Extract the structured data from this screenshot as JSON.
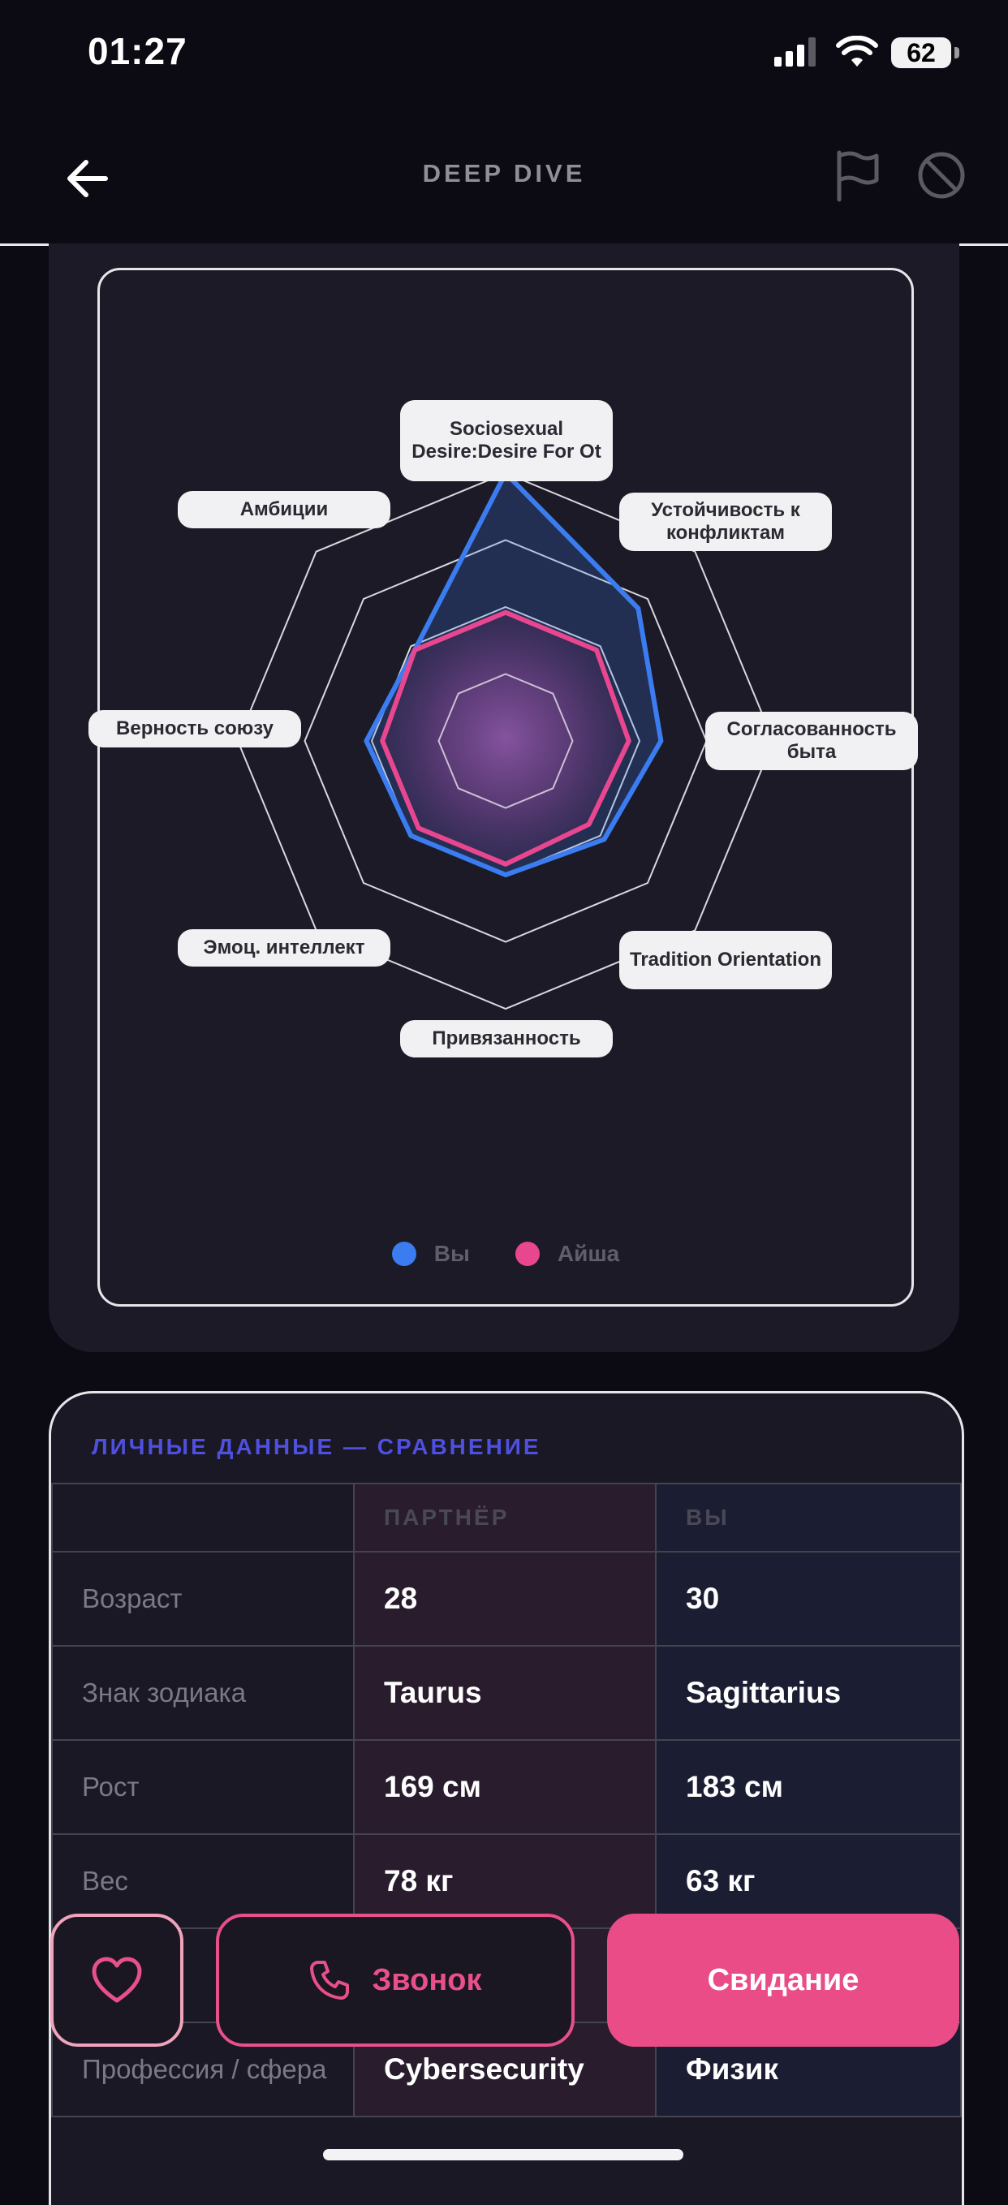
{
  "status": {
    "time": "01:27",
    "battery": "62"
  },
  "nav": {
    "title": "DEEP DIVE"
  },
  "radar": {
    "axes": [
      "Sociosexual Desire:Desire For Ot",
      "Устойчивость к конфликтам",
      "Согласованность быта",
      "Tradition Orientation",
      "Привязанность",
      "Эмоц. интеллект",
      "Верность союзу",
      "Амбиции"
    ],
    "series": [
      {
        "name": "Вы",
        "color": "#3b7cf0",
        "values": [
          1.0,
          0.7,
          0.58,
          0.52,
          0.5,
          0.5,
          0.52,
          0.48
        ]
      },
      {
        "name": "Айша",
        "color": "#e8478f",
        "values": [
          0.48,
          0.48,
          0.46,
          0.44,
          0.46,
          0.46,
          0.46,
          0.48
        ]
      }
    ],
    "legend": {
      "you": "Вы",
      "partner": "Айша"
    }
  },
  "info": {
    "title": "ЛИЧНЫЕ ДАННЫЕ — СРАВНЕНИЕ",
    "headers": {
      "partner": "ПАРТНЁР",
      "you": "ВЫ"
    },
    "rows": [
      {
        "label": "Возраст",
        "partner": "28",
        "you": "30"
      },
      {
        "label": "Знак зодиака",
        "partner": "Taurus",
        "you": "Sagittarius"
      },
      {
        "label": "Рост",
        "partner": "169 см",
        "you": "183 см"
      },
      {
        "label": "Вес",
        "partner": "78 кг",
        "you": "63 кг"
      },
      {
        "label": "",
        "partner": "",
        "you": ""
      },
      {
        "label": "Профессия / сфера",
        "partner": "Cybersecurity",
        "you": "Физик"
      }
    ]
  },
  "actions": {
    "call": "Звонок",
    "date": "Свидание"
  },
  "colors": {
    "accent_pink": "#e94c86",
    "accent_blue": "#3b7cf0",
    "title_purple": "#4f4fe0"
  }
}
